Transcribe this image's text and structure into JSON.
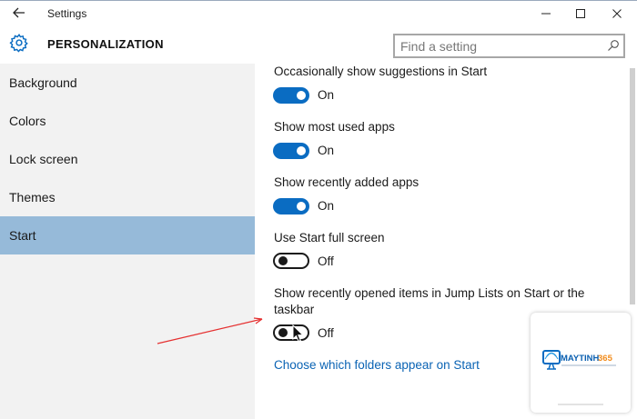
{
  "window": {
    "title": "Settings",
    "back_icon": "arrow-left-icon",
    "min_icon": "minimize-icon",
    "max_icon": "maximize-icon",
    "close_icon": "close-icon"
  },
  "header": {
    "title": "PERSONALIZATION",
    "icon": "gear-icon",
    "search_placeholder": "Find a setting"
  },
  "sidebar": {
    "items": [
      {
        "label": "Background",
        "active": false
      },
      {
        "label": "Colors",
        "active": false
      },
      {
        "label": "Lock screen",
        "active": false
      },
      {
        "label": "Themes",
        "active": false
      },
      {
        "label": "Start",
        "active": true
      }
    ]
  },
  "settings": [
    {
      "label": "Occasionally show suggestions in Start",
      "state": "On",
      "on": true
    },
    {
      "label": "Show most used apps",
      "state": "On",
      "on": true
    },
    {
      "label": "Show recently added apps",
      "state": "On",
      "on": true
    },
    {
      "label": "Use Start full screen",
      "state": "Off",
      "on": false
    },
    {
      "label_line1": "Show recently opened items in Jump Lists on Start or the",
      "label_line2": "taskbar",
      "state": "Off",
      "on": false
    }
  ],
  "link": {
    "label": "Choose which folders appear on Start"
  },
  "watermark": {
    "brand_a": "MAYTINH",
    "brand_b": "365"
  },
  "colors": {
    "accent": "#0a6cc2",
    "sidebar_active": "#96bad9",
    "annotation_arrow": "#e53030"
  }
}
